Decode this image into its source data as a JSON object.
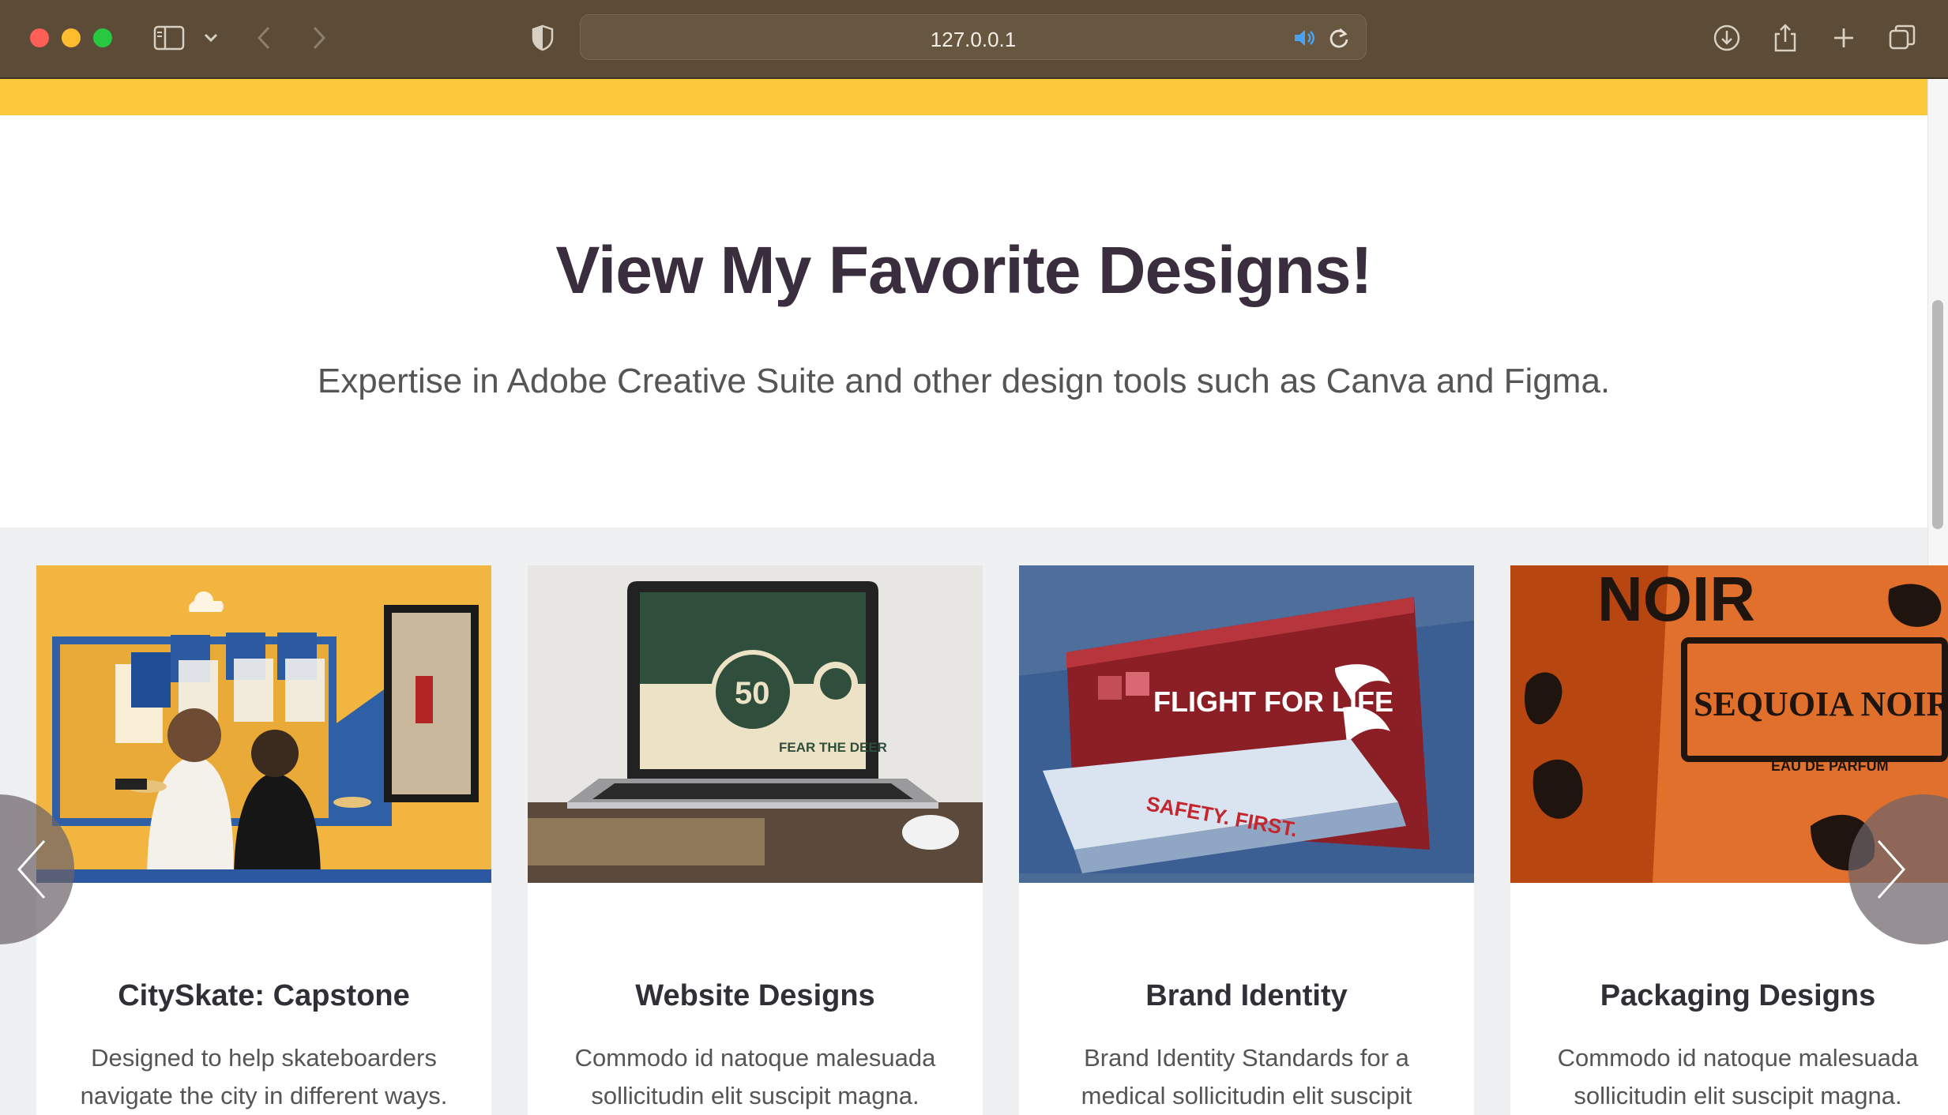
{
  "browser": {
    "url": "127.0.0.1",
    "icons": [
      "sidebar-icon",
      "chevron-down-icon",
      "back-icon",
      "forward-icon",
      "shield-icon",
      "speaker-icon",
      "reload-icon",
      "download-icon",
      "share-icon",
      "new-tab-icon",
      "tabs-overview-icon"
    ]
  },
  "section": {
    "title_regular": "View My Favorite ",
    "title_bold": "Designs",
    "title_end": "!",
    "subtitle": "Expertise in Adobe Creative Suite and other design tools such as Canva and Figma."
  },
  "cards": [
    {
      "title": "CitySkate: Capstone",
      "desc": "Designed to help skateboarders navigate the city in different ways."
    },
    {
      "title": "Website Designs",
      "desc": "Commodo id natoque malesuada sollicitudin elit suscipit magna."
    },
    {
      "title": "Brand Identity",
      "desc": "Brand Identity Standards for a medical sollicitudin elit suscipit magna."
    },
    {
      "title": "Packaging Designs",
      "desc": "Commodo id natoque malesuada sollicitudin elit suscipit magna."
    }
  ],
  "thumb_text": {
    "laptop_number": "50",
    "laptop_caption": "FEAR THE DEER",
    "brand_sign": "FLIGHT FOR LIFE",
    "brand_desk": "SAFETY. FIRST.",
    "pkg_noir": "NOIR",
    "pkg_brand": "SEQUOIA NOIR",
    "pkg_sub": "EAU DE PARFUM"
  },
  "colors": {
    "accent_yellow": "#fbc93a",
    "heading": "#3a2d3d",
    "gallery_bg": "#eef0f2"
  }
}
